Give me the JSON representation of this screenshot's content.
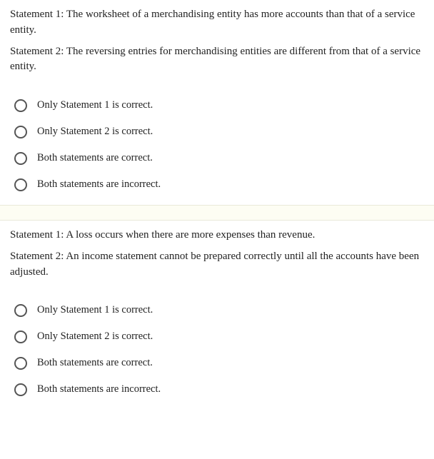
{
  "questions": [
    {
      "prompt": [
        "Statement 1: The worksheet of a merchandising entity has more accounts than that of a service entity.",
        "Statement 2: The reversing entries for merchandising entities are different from that of a service entity."
      ],
      "options": [
        "Only Statement 1 is correct.",
        "Only Statement 2 is correct.",
        "Both statements are correct.",
        "Both statements are incorrect."
      ]
    },
    {
      "prompt": [
        "Statement 1: A loss occurs when there are more expenses than revenue.",
        "Statement 2: An income statement cannot be prepared correctly until all the accounts have been adjusted."
      ],
      "options": [
        "Only Statement 1 is correct.",
        "Only Statement 2 is correct.",
        "Both statements are correct.",
        "Both statements are incorrect."
      ]
    }
  ]
}
